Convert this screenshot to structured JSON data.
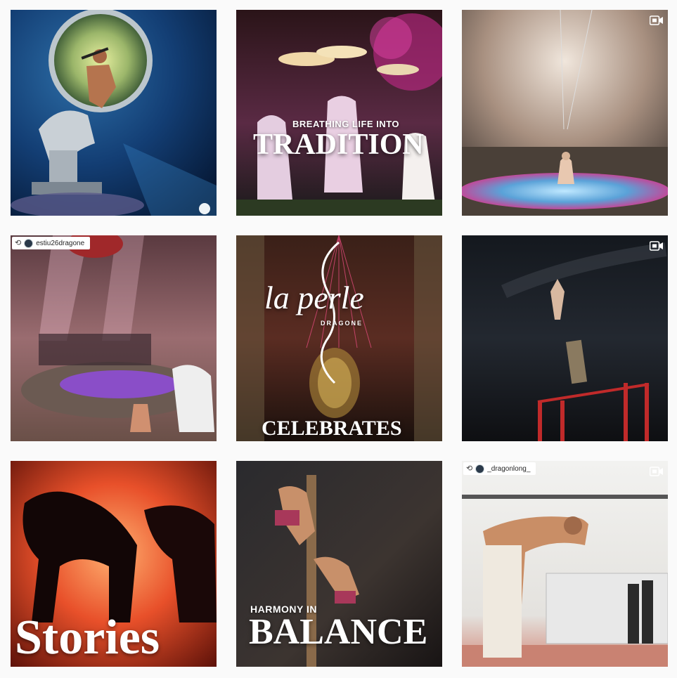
{
  "grid": {
    "posts": [
      {
        "id": "p1",
        "caption_small": "",
        "caption_big": "",
        "is_video": false,
        "repost_user": ""
      },
      {
        "id": "p2",
        "caption_small": "BREATHING LIFE INTO",
        "caption_big": "TRADITION",
        "is_video": false,
        "repost_user": ""
      },
      {
        "id": "p3",
        "caption_small": "",
        "caption_big": "",
        "is_video": true,
        "repost_user": ""
      },
      {
        "id": "p4",
        "caption_small": "",
        "caption_big": "",
        "is_video": false,
        "repost_user": "estiu26dragone"
      },
      {
        "id": "p5",
        "caption_small": "DRAGONE",
        "caption_big": "CELEBRATES",
        "logo_text": "la perle",
        "is_video": false,
        "repost_user": ""
      },
      {
        "id": "p6",
        "caption_small": "",
        "caption_big": "",
        "is_video": true,
        "repost_user": ""
      },
      {
        "id": "p7",
        "caption_small": "",
        "caption_big": "Stories",
        "is_video": false,
        "repost_user": ""
      },
      {
        "id": "p8",
        "caption_small": "HARMONY IN",
        "caption_big": "BALANCE",
        "is_video": false,
        "repost_user": ""
      },
      {
        "id": "p9",
        "caption_small": "",
        "caption_big": "",
        "is_video": true,
        "repost_user": "_dragonlong_"
      }
    ]
  },
  "icons": {
    "video": "video-camera-icon",
    "repost": "repost-icon"
  },
  "colors": {
    "background": "#fafafa",
    "badge_bg": "#ffffff"
  }
}
